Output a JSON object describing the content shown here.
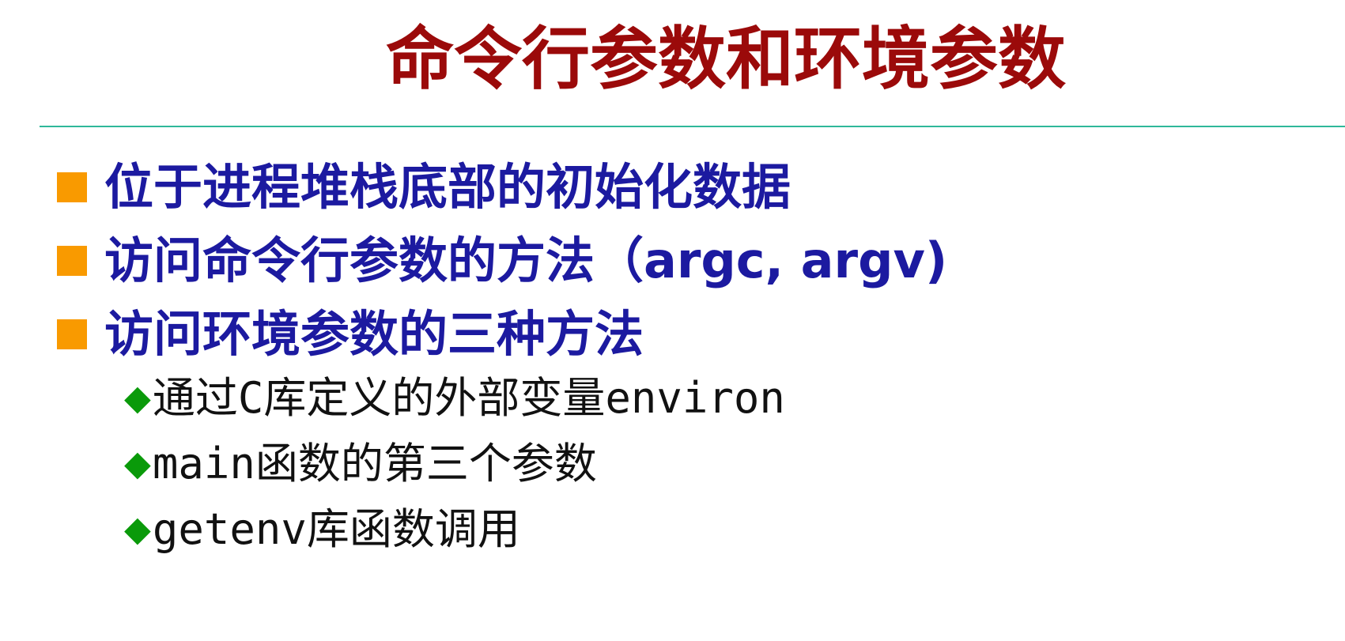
{
  "slide": {
    "title": "命令行参数和环境参数",
    "bullets": [
      "位于进程堆栈底部的初始化数据",
      "访问命令行参数的方法（argc, argv)",
      "访问环境参数的三种方法"
    ],
    "sub_bullets": [
      "通过C库定义的外部变量environ",
      "main函数的第三个参数",
      "getenv库函数调用"
    ]
  },
  "colors": {
    "title": "#9b0a0a",
    "bullet_text": "#1c1aa0",
    "bullet_square": "#f99a00",
    "sub_marker": "#0a9a0a",
    "divider": "#2fb89a"
  }
}
